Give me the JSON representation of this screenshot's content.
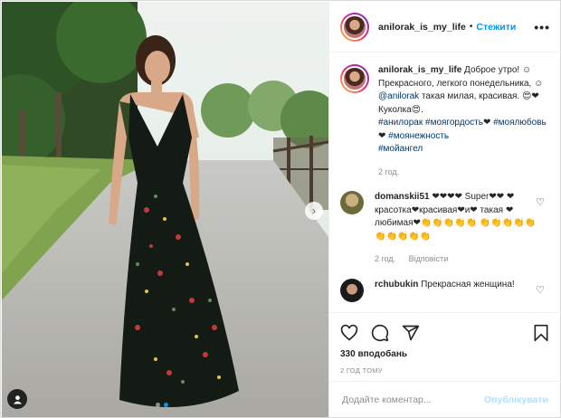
{
  "header": {
    "username": "anilorak_is_my_life",
    "separator": "•",
    "follow_label": "Стежити",
    "more_label": "•••"
  },
  "caption": {
    "username": "anilorak_is_my_life",
    "text_1": " Доброе утро! ☺ Прекрасного, легкого понедельника, ☺ ",
    "mention": "@anilorak",
    "text_2": " такая милая, красивая. 😍❤ Куколка😍.",
    "hashtags": [
      "#анилорак",
      "#моягордость",
      "#моялюбовь",
      "#моянежность",
      "#мойангел"
    ],
    "hashtag_suffix": [
      "",
      "❤",
      "❤",
      "",
      ""
    ],
    "time": "2 год."
  },
  "comments": [
    {
      "username": "domanskii51",
      "text": " ❤❤❤❤ Super❤❤ ❤красотка❤красивая❤и❤ такая ❤любимая❤👏👏👏👏👏 👏👏👏👏👏👏👏👏👏👏",
      "time": "2 год.",
      "reply_label": "Відповісти"
    },
    {
      "username": "rchubukin",
      "text": " Прекрасная женщина!"
    }
  ],
  "actions": {
    "likes": "330 вподобань",
    "time_ago": "2 ГОД ТОМУ"
  },
  "add_comment": {
    "placeholder": "Додайте коментар...",
    "post_label": "Опублікувати"
  },
  "nav": {
    "next_icon": "›"
  },
  "carousel": {
    "slide_count": 2,
    "active_slide": 1
  }
}
